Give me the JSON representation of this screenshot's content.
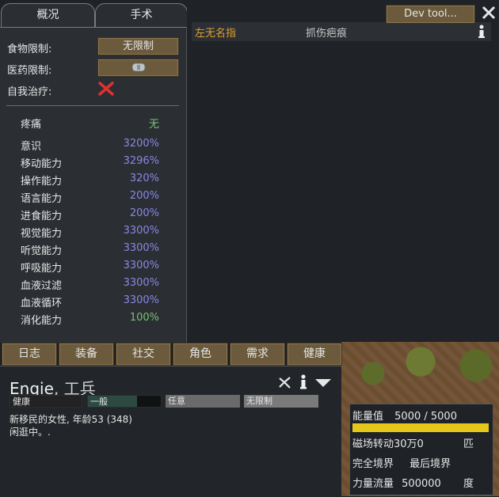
{
  "tabs": {
    "overview": "概况",
    "surgery": "手术"
  },
  "dev_tool": "Dev tool...",
  "settings": {
    "food_label": "食物限制:",
    "food_value": "无限制",
    "medicine_label": "医药限制:",
    "self_tend_label": "自我治疗:"
  },
  "pain": {
    "name": "疼痛",
    "value": "无"
  },
  "capacities": [
    {
      "name": "意识",
      "value": "3200%"
    },
    {
      "name": "移动能力",
      "value": "3296%"
    },
    {
      "name": "操作能力",
      "value": "320%"
    },
    {
      "name": "语言能力",
      "value": "200%"
    },
    {
      "name": "进食能力",
      "value": "200%"
    },
    {
      "name": "视觉能力",
      "value": "3300%"
    },
    {
      "name": "听觉能力",
      "value": "3300%"
    },
    {
      "name": "呼吸能力",
      "value": "3300%"
    },
    {
      "name": "血液过滤",
      "value": "3300%"
    },
    {
      "name": "血液循环",
      "value": "3300%"
    },
    {
      "name": "消化能力",
      "value": "100%"
    }
  ],
  "hediff": {
    "part": "左无名指",
    "condition": "抓伤疤痕"
  },
  "bottom_tabs": [
    "日志",
    "装备",
    "社交",
    "角色",
    "需求",
    "健康"
  ],
  "pawn": {
    "name": "Engie",
    "title": ", 工兵",
    "bars": [
      "健康",
      "一般",
      "任意",
      "无限制"
    ],
    "desc1": "新移民的女性, 年龄53 (348)",
    "desc2": "闲逛中。."
  },
  "power": {
    "energy_label": "能量值",
    "energy_value": "5000 / 5000",
    "energy_fraction": 1.0,
    "line2_a": "磁场转动30万0",
    "line2_b": "匹",
    "line3_a": "完全境界",
    "line3_b": "最后境界",
    "line4_a": "力量流量",
    "line4_b": "500000",
    "line4_c": "度"
  },
  "colors": {
    "accent_yellow": "#e6c619",
    "hediff_orange": "#e0a030",
    "capacity_purple": "#8a86e6",
    "capacity_green": "#7bbf7b"
  }
}
